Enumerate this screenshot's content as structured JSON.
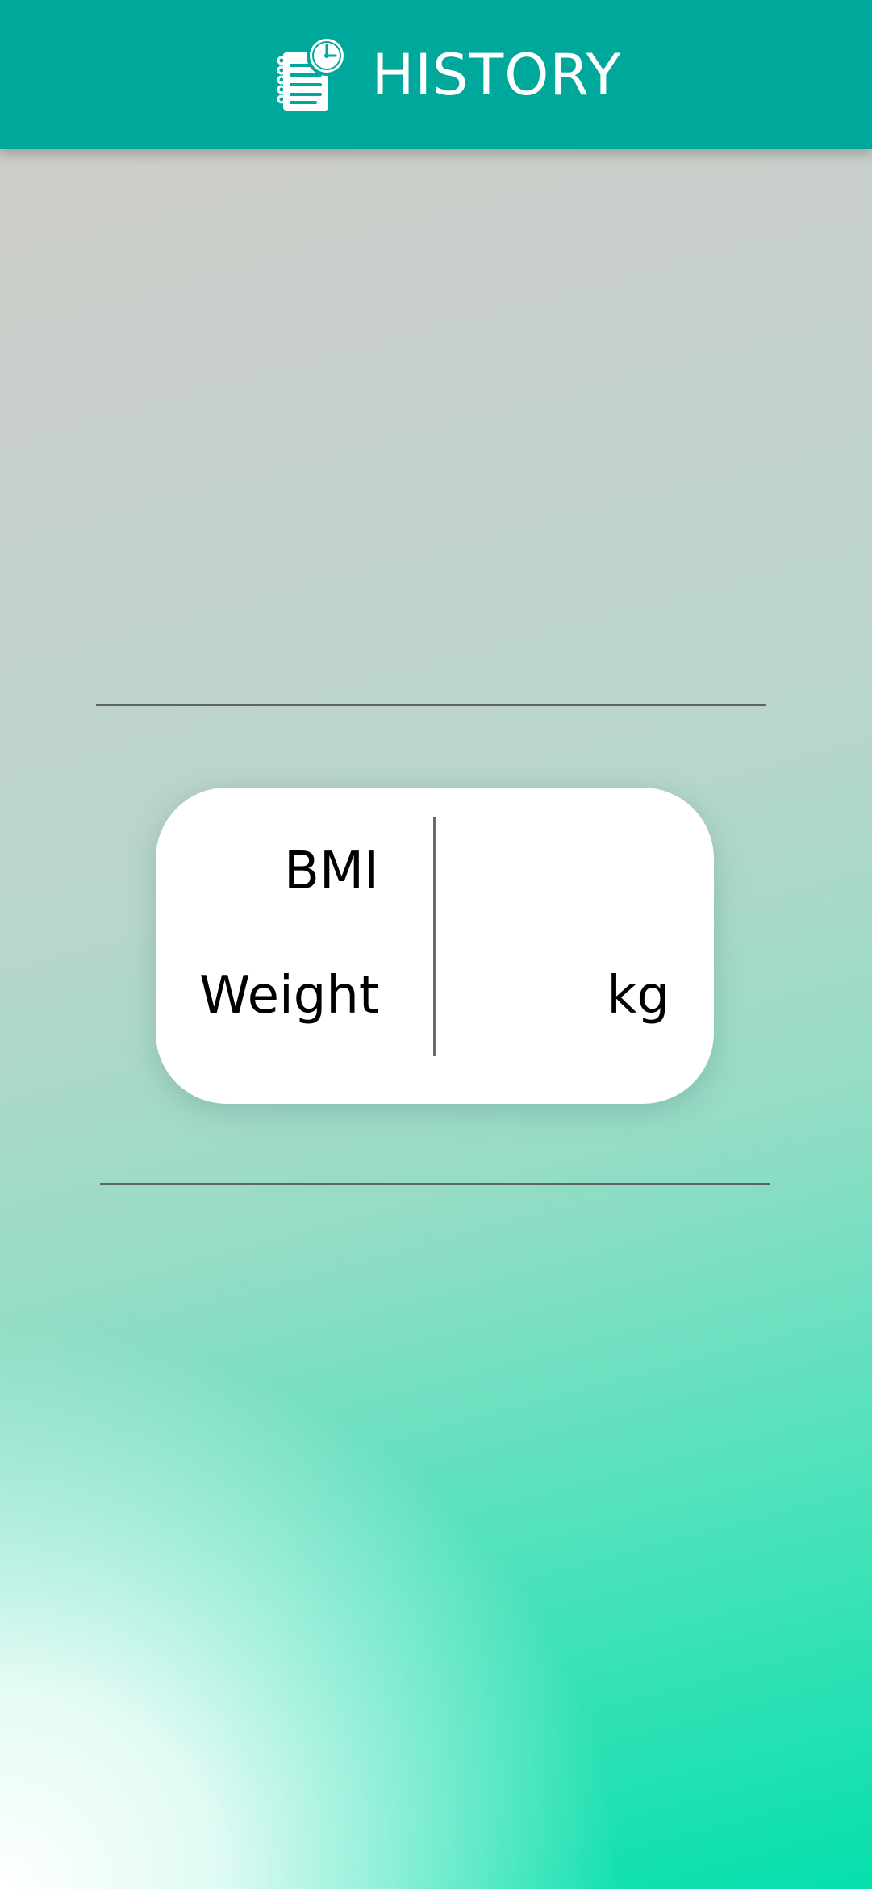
{
  "header": {
    "title": "HISTORY",
    "icon": "history-notebook-clock-icon",
    "background_color": "#00a89c"
  },
  "summary": {
    "bmi_label": "BMI",
    "bmi_value": "",
    "weight_label": "Weight",
    "weight_value": "",
    "weight_unit": "kg"
  },
  "colors": {
    "accent": "#00a89c",
    "gradient_end": "#05e0ac",
    "divider": "#5f6563"
  }
}
